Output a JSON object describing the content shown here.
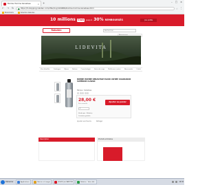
{
  "browser": {
    "tab_title": "Bombe Homme Kerastase",
    "tab_close": "×",
    "new_tab": "+",
    "window_controls": [
      "–",
      "□",
      "×"
    ],
    "url": "https://fr.shopping.rakuten.com/offer/buy/4190884/bombe-homme-kerastase.html",
    "bookmarks": [
      "Bookmarks",
      "Sélection Rakuten"
    ]
  },
  "promo": {
    "big_text": "10 millions",
    "club_label": "Club",
    "small_text": "jusqu'à",
    "percent": "30%",
    "reimbursed": "REMBOURSÉS",
    "mini_cta": "J'en profite"
  },
  "header": {
    "logo": "Rakuten",
    "search_placeholder": "Rechercher"
  },
  "hero": {
    "brand": "LIDEVITA"
  },
  "catnav": [
    "Vue détaillée",
    "Catalogue",
    "Bijoux",
    "Parfum",
    "Cosmétologie",
    "Soins du corps",
    "Meilleures ventes",
    "Nouveautés",
    "Outlet"
  ],
  "product": {
    "title": "BOMBE HOMME KERASTASE ELIXIR ULTIME COLORADOR SUPERIOR CLASSIC",
    "brand_line": "Marque : Kerastase",
    "price": "28,00 €",
    "price_label": "Prix conseillé",
    "cart_button": "Ajouter au panier",
    "qty": "1",
    "line1": "Vendu par : Rakuten",
    "line2": "Livraison gratuite",
    "fav": "Ajouter aux favoris",
    "share": "Partager"
  },
  "side_banner": "Abonnement",
  "sections": {
    "left": "Description",
    "right": "Produits similaires"
  },
  "taskbar": {
    "start": "Démarrer",
    "items": [
      "Applications",
      "Galeries et images",
      "[PLACE] de RAKUTEN",
      "Rakuten - Votre bib..."
    ],
    "clock": "14:32"
  },
  "colors": {
    "accent": "#d81b2a",
    "taskbar": "#d6dbe4"
  }
}
